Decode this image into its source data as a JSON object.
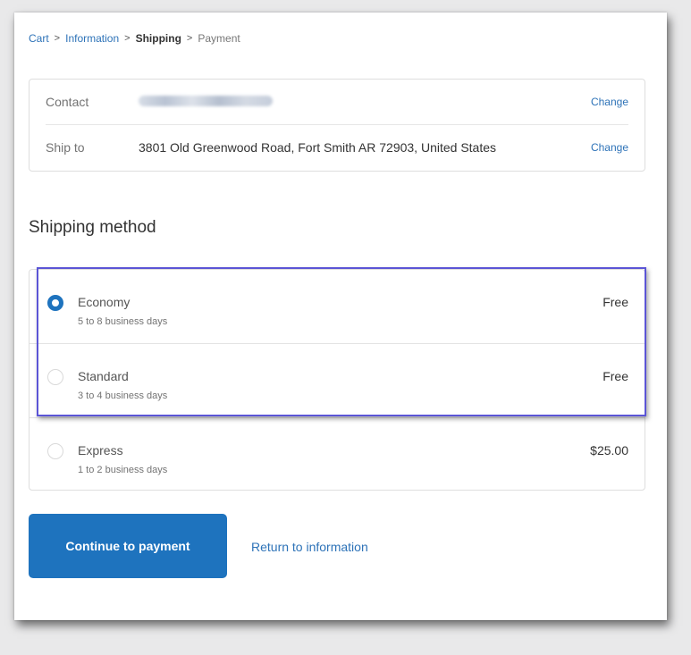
{
  "breadcrumb": {
    "cart": "Cart",
    "information": "Information",
    "shipping": "Shipping",
    "payment": "Payment",
    "separator": ">"
  },
  "review": {
    "contact_label": "Contact",
    "ship_to_label": "Ship to",
    "ship_to_value": "3801 Old Greenwood Road, Fort Smith AR 72903, United States",
    "change_label": "Change"
  },
  "shipping": {
    "title": "Shipping method",
    "methods": [
      {
        "name": "Economy",
        "detail": "5 to 8 business days",
        "price": "Free",
        "selected": true
      },
      {
        "name": "Standard",
        "detail": "3 to 4 business days",
        "price": "Free",
        "selected": false
      },
      {
        "name": "Express",
        "detail": "1 to 2 business days",
        "price": "$25.00",
        "selected": false
      }
    ]
  },
  "actions": {
    "continue_label": "Continue to payment",
    "return_label": "Return to information"
  },
  "colors": {
    "accent": "#1e73be",
    "link": "#2e73b8",
    "highlight": "#5b55d6"
  }
}
